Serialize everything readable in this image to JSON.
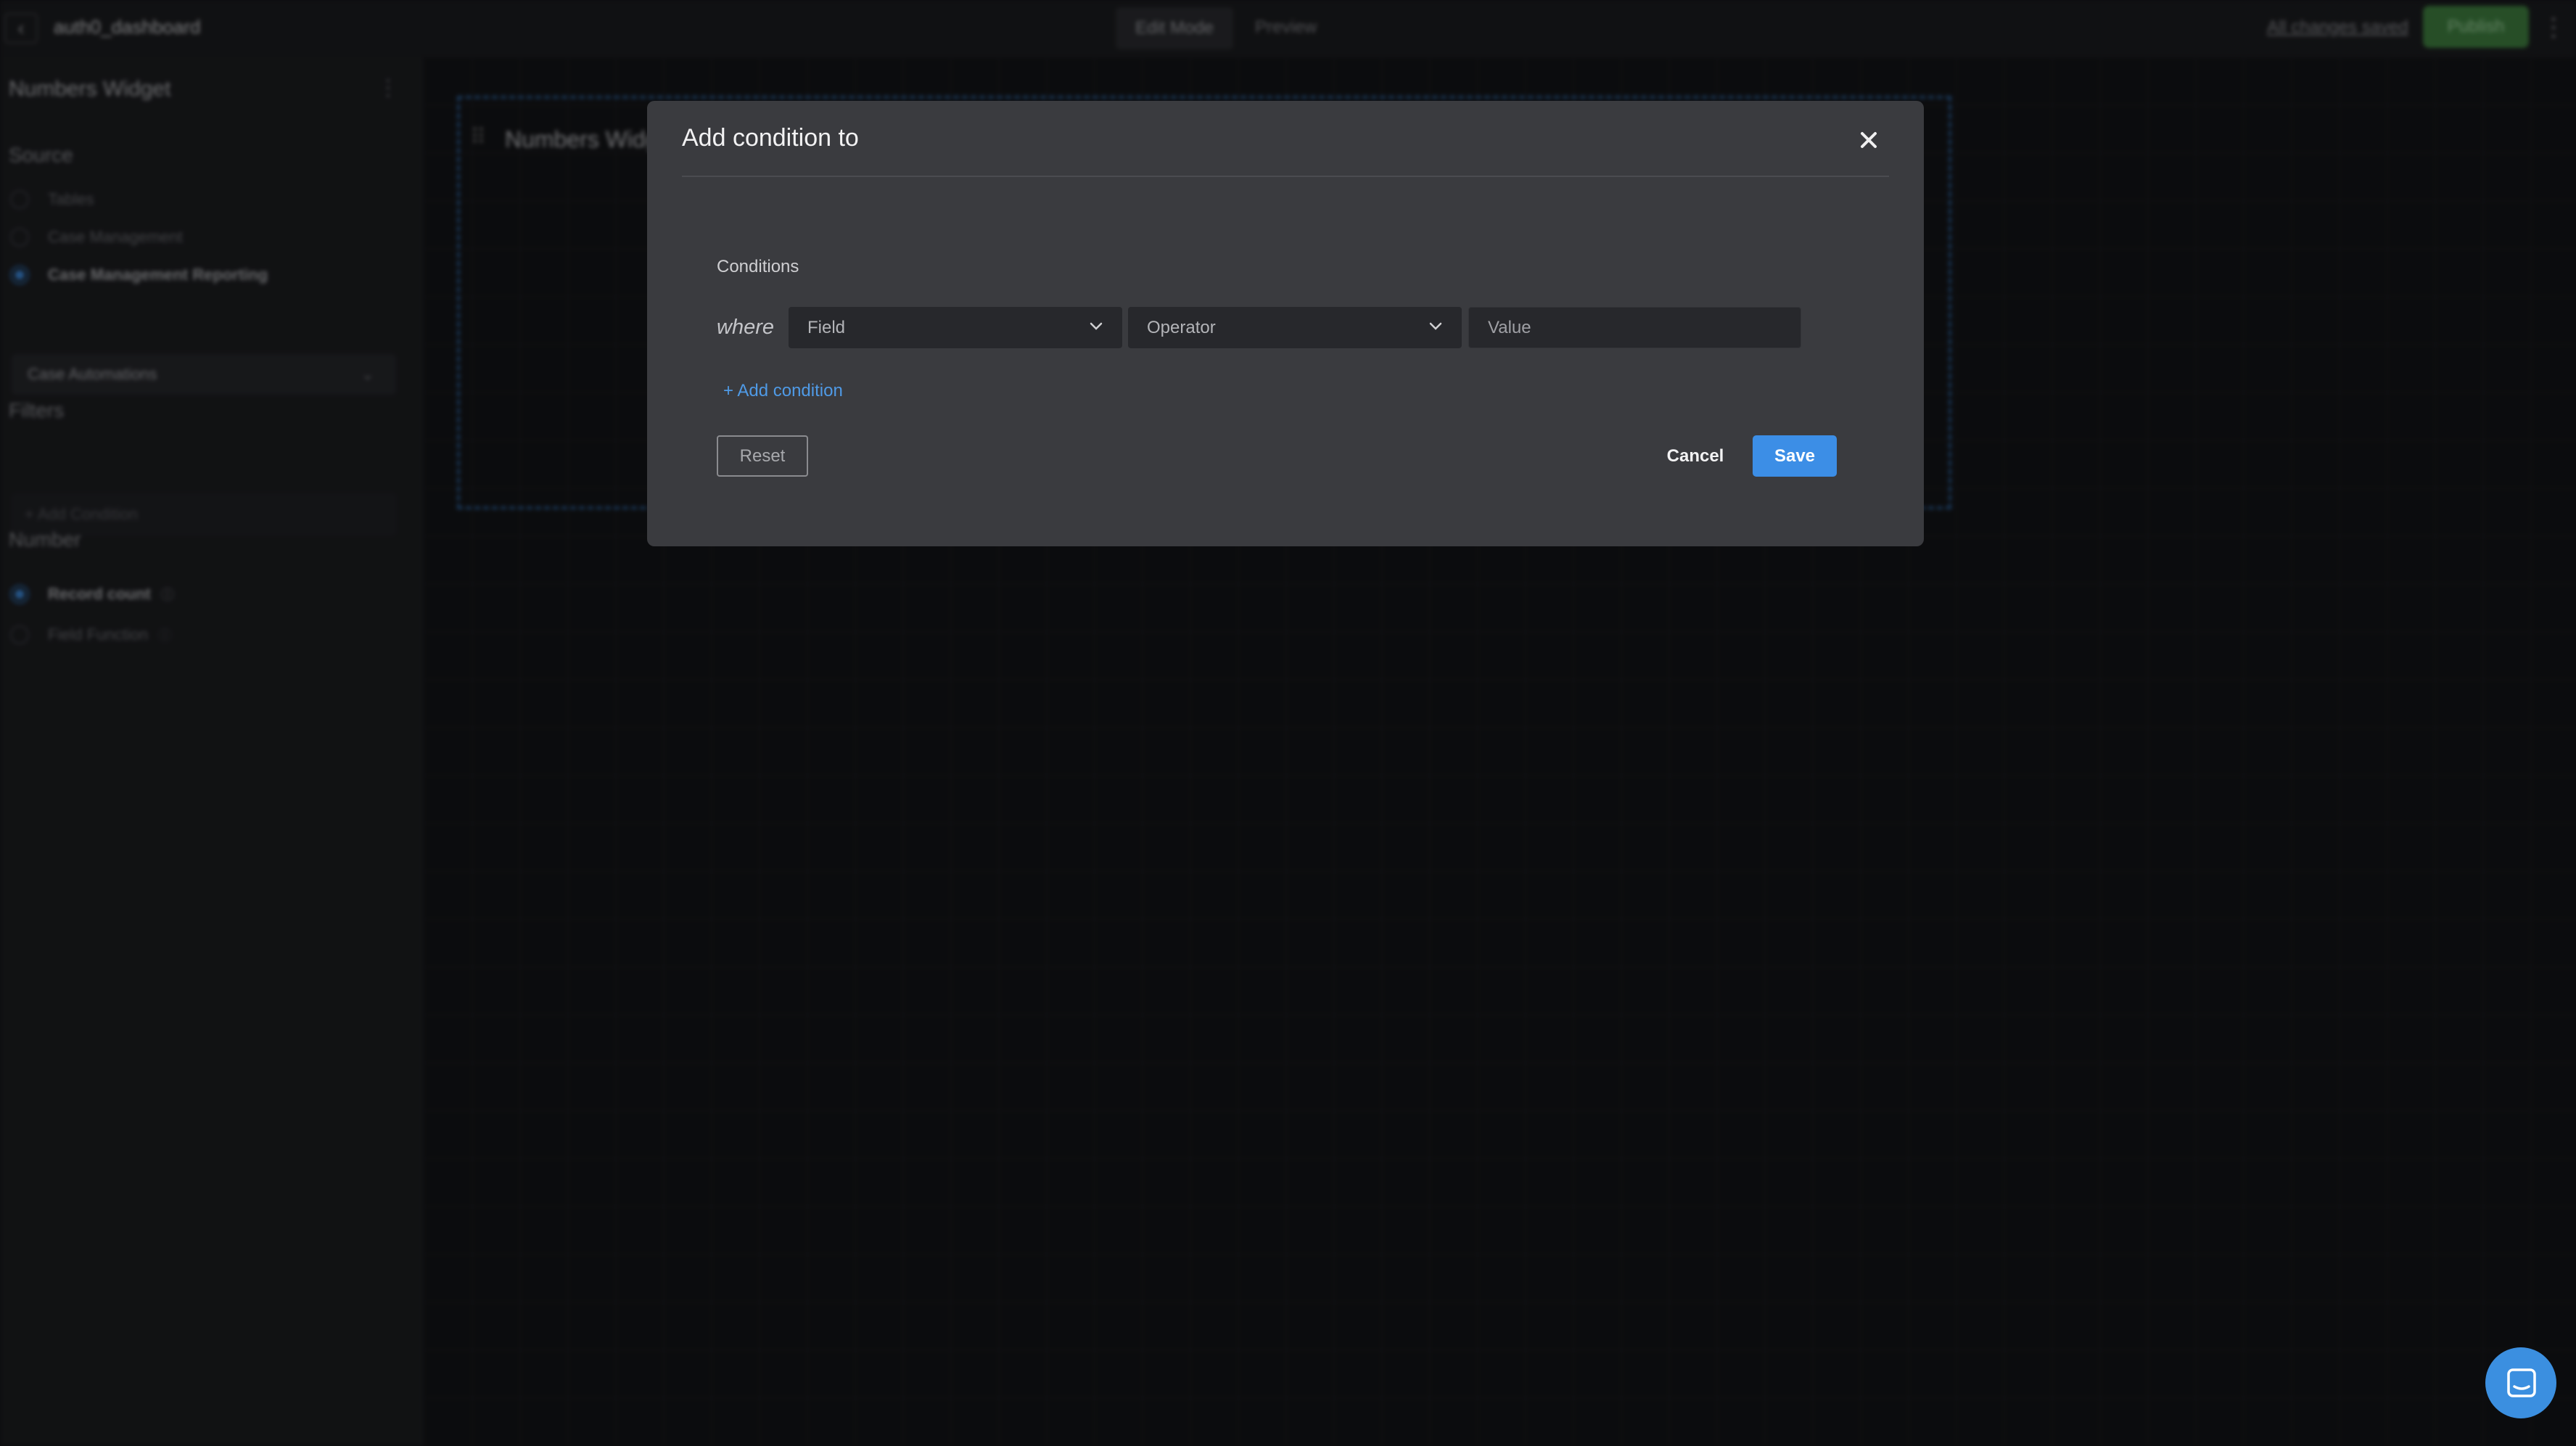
{
  "app": {
    "back_icon": "chevron-left-icon",
    "title": "auth0_dashboard",
    "modes": [
      "Edit Mode",
      "Preview"
    ],
    "saved_status": "All changes saved",
    "publish_label": "Publish",
    "menu_icon": "kebab-icon"
  },
  "sidebar": {
    "title": "Numbers Widget",
    "source_heading": "Source",
    "sources": [
      {
        "label": "Tables",
        "selected": false
      },
      {
        "label": "Case Management",
        "selected": false
      },
      {
        "label": "Case Management Reporting",
        "selected": true
      }
    ],
    "source_select_value": "Case Automations",
    "filters_heading": "Filters",
    "add_condition_label": "+ Add Condition",
    "number_heading": "Number",
    "number_options": [
      {
        "label": "Record count",
        "selected": true
      },
      {
        "label": "Field Function",
        "selected": false
      }
    ]
  },
  "canvas": {
    "widget_title": "Numbers Widget"
  },
  "modal": {
    "title": "Add condition to",
    "close_icon": "close-icon",
    "conditions_label": "Conditions",
    "where_label": "where",
    "field_placeholder": "Field",
    "operator_placeholder": "Operator",
    "value_placeholder": "Value",
    "add_condition_link": "+ Add condition",
    "reset_label": "Reset",
    "cancel_label": "Cancel",
    "save_label": "Save"
  },
  "colors": {
    "accent": "#3c8ee6",
    "link": "#4f9ae6",
    "modal_bg": "#3a3b3f",
    "publish_green": "#3f7f40"
  },
  "chat": {
    "icon": "chat-bubble-icon"
  }
}
